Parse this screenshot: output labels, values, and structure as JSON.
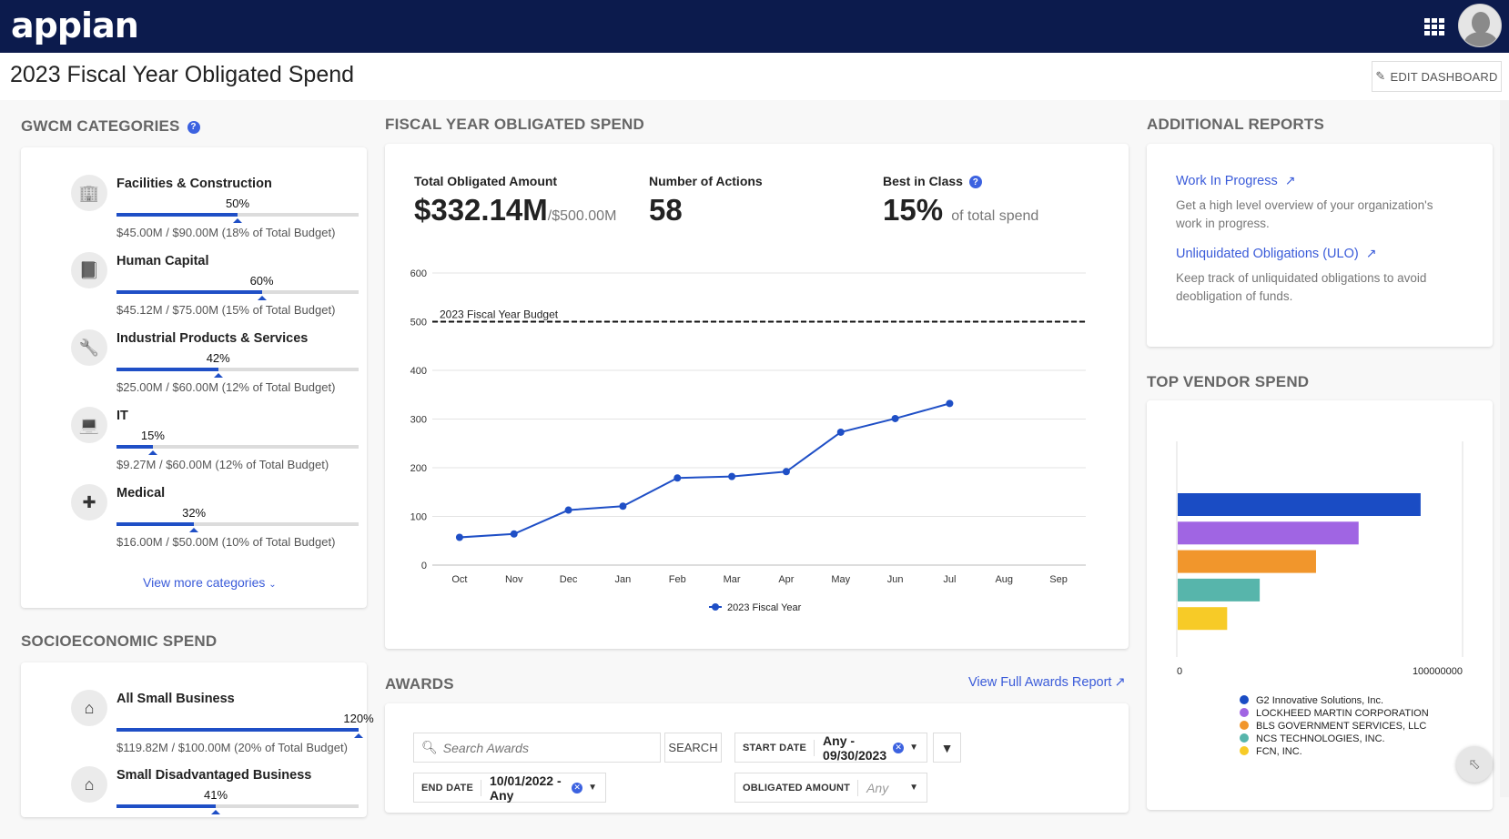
{
  "app": {
    "logo": "appian",
    "page_title": "2023 Fiscal Year Obligated Spend",
    "edit_dashboard": "EDIT DASHBOARD"
  },
  "gwcm": {
    "title": "GWCM CATEGORIES",
    "items": [
      {
        "name": "Facilities & Construction",
        "icon": "building-icon",
        "percent": 50,
        "percent_label": "50%",
        "amount": "$45.00M / $90.00M (18% of Total Budget)"
      },
      {
        "name": "Human Capital",
        "icon": "book-icon",
        "percent": 60,
        "percent_label": "60%",
        "amount": "$45.12M / $75.00M (15% of Total Budget)"
      },
      {
        "name": "Industrial Products & Services",
        "icon": "wrench-icon",
        "percent": 42,
        "percent_label": "42%",
        "amount": "$25.00M / $60.00M (12% of Total Budget)"
      },
      {
        "name": "IT",
        "icon": "laptop-icon",
        "percent": 15,
        "percent_label": "15%",
        "amount": "$9.27M / $60.00M (12% of Total Budget)"
      },
      {
        "name": "Medical",
        "icon": "medkit-icon",
        "percent": 32,
        "percent_label": "32%",
        "amount": "$16.00M / $50.00M (10% of Total Budget)"
      }
    ],
    "view_more": "View more categories"
  },
  "socio": {
    "title": "SOCIOECONOMIC SPEND",
    "items": [
      {
        "name": "All Small Business",
        "icon": "home-icon",
        "percent": 120,
        "percent_label": "120%",
        "amount": "$119.82M / $100.00M (20% of Total Budget)"
      },
      {
        "name": "Small Disadvantaged Business",
        "icon": "home-icon",
        "percent": 41,
        "percent_label": "41%",
        "amount": ""
      }
    ]
  },
  "fiscal": {
    "title": "FISCAL YEAR OBLIGATED SPEND",
    "kpis": {
      "total_label": "Total Obligated Amount",
      "total_value": "$332.14M",
      "total_of": "/$500.00M",
      "actions_label": "Number of Actions",
      "actions_value": "58",
      "bic_label": "Best in Class",
      "bic_value": "15%",
      "bic_suffix": "of total spend"
    }
  },
  "chart_data": [
    {
      "type": "line",
      "title": "",
      "x": [
        "Oct",
        "Nov",
        "Dec",
        "Jan",
        "Feb",
        "Mar",
        "Apr",
        "May",
        "Jun",
        "Jul",
        "Aug",
        "Sep"
      ],
      "series": [
        {
          "name": "2023 Fiscal Year",
          "color": "#1f4fc6",
          "values": [
            57,
            64,
            113,
            121,
            179,
            182,
            192,
            273,
            301,
            332,
            null,
            null
          ]
        }
      ],
      "reference_line": {
        "label": "2023 Fiscal Year Budget",
        "value": 500
      },
      "yticks": [
        0,
        100,
        200,
        300,
        400,
        500,
        600
      ],
      "ylim": [
        0,
        600
      ],
      "xlabel": "",
      "ylabel": "",
      "grid": true,
      "legend": "bottom"
    },
    {
      "type": "bar",
      "orientation": "horizontal",
      "title": "",
      "categories": [
        "G2 Innovative Solutions, Inc.",
        "LOCKHEED MARTIN CORPORATION",
        "BLS GOVERNMENT SERVICES, LLC",
        "NCS TECHNOLOGIES, INC.",
        "FCN, INC."
      ],
      "values": [
        85000000,
        63300000,
        48400000,
        28700000,
        17300000
      ],
      "colors": [
        "#1a4cc4",
        "#a065e3",
        "#f1962c",
        "#57b5ab",
        "#f7cb27"
      ],
      "xticks": [
        "0",
        "100000000"
      ],
      "xlim": [
        0,
        100000000
      ],
      "legend": "bottom"
    }
  ],
  "reports": {
    "title": "ADDITIONAL REPORTS",
    "items": [
      {
        "label": "Work In Progress",
        "desc": "Get a high level overview of your organization's work in progress."
      },
      {
        "label": "Unliquidated Obligations (ULO)",
        "desc": "Keep track of unliquidated obligations to avoid deobligation of funds."
      }
    ]
  },
  "vendor": {
    "title": "TOP VENDOR SPEND"
  },
  "awards": {
    "title": "AWARDS",
    "full_report": "View Full Awards Report",
    "search_placeholder": "Search Awards",
    "search_button": "SEARCH",
    "start_date_label": "START DATE",
    "start_date_value": "Any - 09/30/2023",
    "end_date_label": "END DATE",
    "end_date_value": "10/01/2022 - Any",
    "obligated_label": "OBLIGATED AMOUNT",
    "obligated_placeholder": "Any"
  }
}
